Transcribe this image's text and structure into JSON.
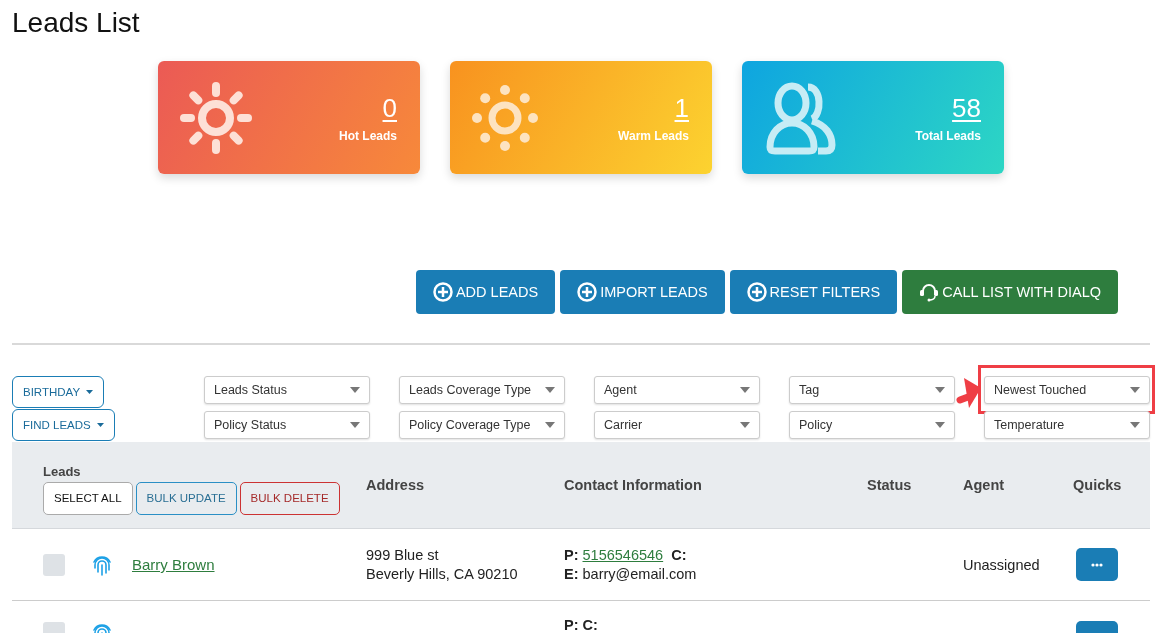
{
  "page": {
    "title": "Leads List"
  },
  "stats": [
    {
      "kind": "hot",
      "value": "0",
      "label": "Hot Leads"
    },
    {
      "kind": "warm",
      "value": "1",
      "label": "Warm Leads"
    },
    {
      "kind": "total",
      "value": "58",
      "label": "Total Leads"
    }
  ],
  "actions": [
    {
      "kind": "add",
      "label": "ADD LEADS"
    },
    {
      "kind": "add",
      "label": "IMPORT LEADS"
    },
    {
      "kind": "add",
      "label": "RESET FILTERS"
    },
    {
      "kind": "call",
      "label": "CALL LIST WITH DIALQ"
    }
  ],
  "dropdown_buttons": [
    "BIRTHDAY",
    "FIND LEADS"
  ],
  "filters": [
    {
      "label": "Leads Status",
      "highlighted": false
    },
    {
      "label": "Leads Coverage Type",
      "highlighted": false
    },
    {
      "label": "Agent",
      "highlighted": false
    },
    {
      "label": "Tag",
      "highlighted": false
    },
    {
      "label": "Newest Touched",
      "highlighted": true
    },
    {
      "label": "Policy Status",
      "highlighted": false
    },
    {
      "label": "Policy Coverage Type",
      "highlighted": false
    },
    {
      "label": "Carrier",
      "highlighted": false
    },
    {
      "label": "Policy",
      "highlighted": false
    },
    {
      "label": "Temperature",
      "highlighted": false
    }
  ],
  "table": {
    "columns": [
      "Leads",
      "Address",
      "Contact Information",
      "Status",
      "Agent",
      "Quicks"
    ],
    "bulk_actions": [
      {
        "kind": "neutral",
        "label": "SELECT ALL"
      },
      {
        "kind": "info",
        "label": "BULK UPDATE"
      },
      {
        "kind": "danger",
        "label": "BULK DELETE"
      }
    ],
    "rows": [
      {
        "checked": false,
        "name": "Barry Brown",
        "address_lines": [
          "999 Blue st",
          "Beverly Hills, CA 90210"
        ],
        "phone_label": "P:",
        "phone": "5156546546",
        "cell_label": "C:",
        "email_label": "E:",
        "email": "barry@email.com",
        "agent": "Unassigned"
      },
      {
        "checked": false,
        "phone_label": "P:",
        "cell_label": "C:"
      }
    ]
  }
}
